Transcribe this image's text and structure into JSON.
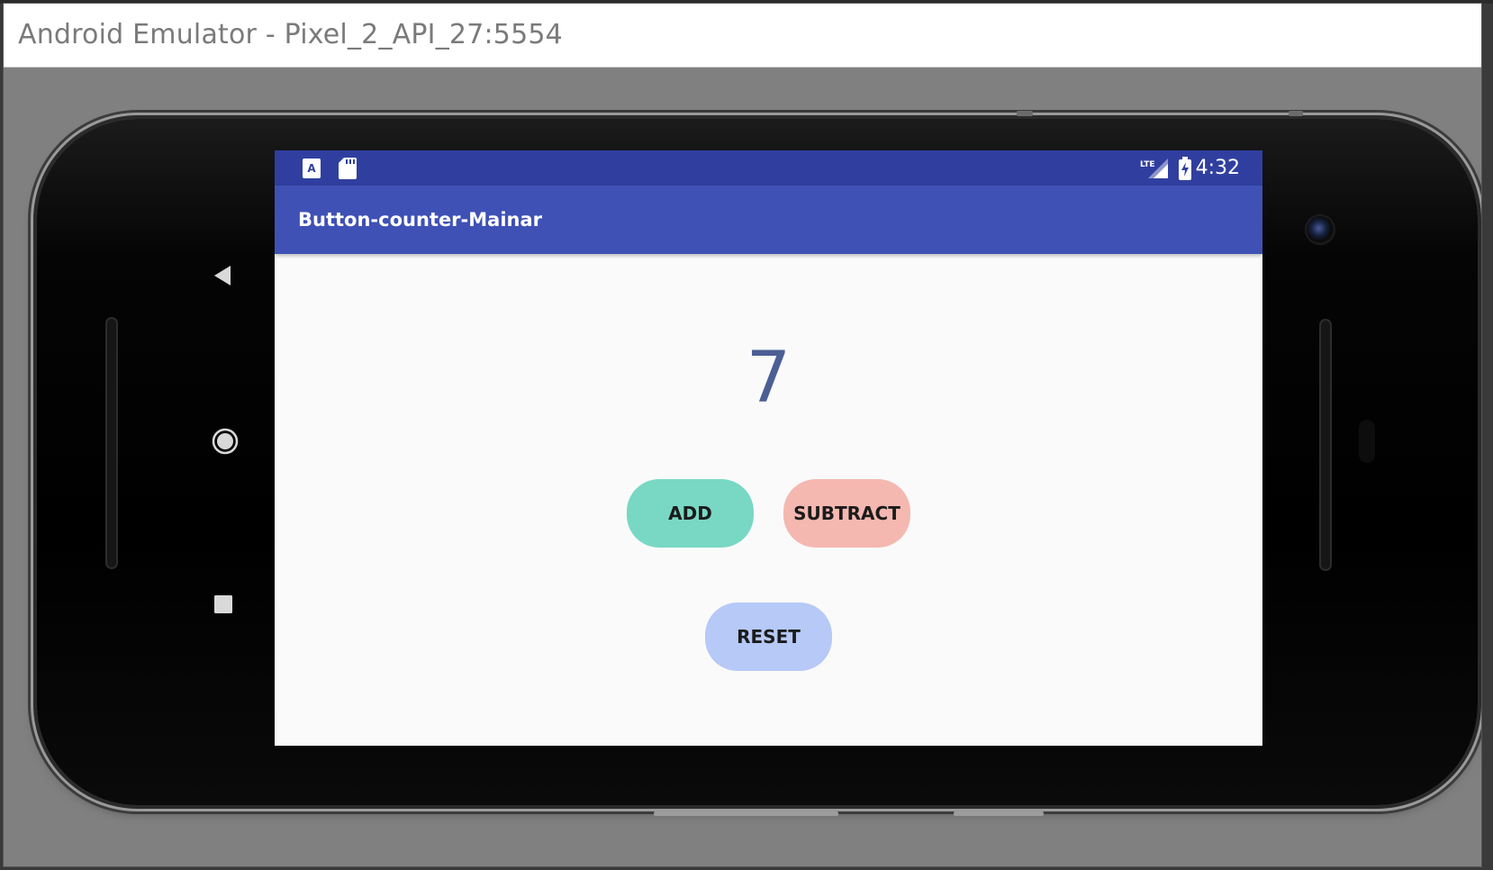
{
  "window": {
    "title": "Android Emulator - Pixel_2_API_27:5554"
  },
  "status_bar": {
    "time": "4:32",
    "network_label": "LTE",
    "left_icons": [
      "text-a-notification-icon",
      "sd-card-icon"
    ],
    "right_icons": [
      "lte-signal-icon",
      "battery-charging-icon"
    ],
    "background_color": "#303f9f"
  },
  "app_bar": {
    "title": "Button-counter-Mainar",
    "background_color": "#3f51b5"
  },
  "counter": {
    "value": "7",
    "color": "#4b5f95"
  },
  "buttons": {
    "add": {
      "label": "ADD",
      "color": "#78d8c4"
    },
    "subtract": {
      "label": "SUBTRACT",
      "color": "#f4b8b1"
    },
    "reset": {
      "label": "RESET",
      "color": "#b6c9f7"
    }
  },
  "nav": {
    "icons": [
      "back-triangle-icon",
      "home-circle-icon",
      "recents-square-icon"
    ]
  }
}
